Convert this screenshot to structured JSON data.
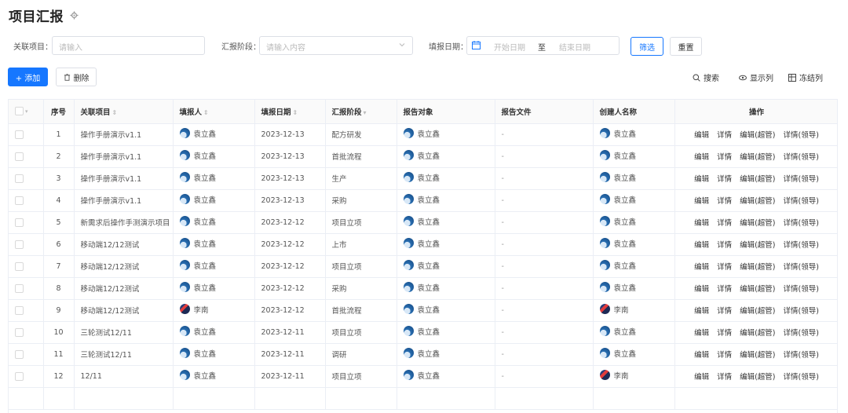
{
  "page": {
    "title": "项目汇报"
  },
  "filters": {
    "project_label": "关联项目：",
    "project_placeholder": "请输入",
    "stage_label": "汇报阶段：",
    "stage_placeholder": "请输入内容",
    "date_label": "填报日期：",
    "date_start_placeholder": "开始日期",
    "date_separator": "至",
    "date_end_placeholder": "结束日期",
    "filter_button": "筛选",
    "reset_button": "重置"
  },
  "toolbar": {
    "add_button": "+ 添加",
    "delete_button": "删除",
    "search": "搜索",
    "columns": "显示列",
    "freeze": "冻结列"
  },
  "table": {
    "headers": {
      "index": "序号",
      "project": "关联项目",
      "reporter": "填报人",
      "date": "填报日期",
      "stage": "汇报阶段",
      "target": "报告对象",
      "file": "报告文件",
      "creator": "创建人名称",
      "actions": "操作"
    },
    "actions": [
      "编辑",
      "详情",
      "编辑(超管)",
      "详情(领导)"
    ],
    "rows": [
      {
        "index": "1",
        "project": "操作手册演示v1.1",
        "reporter": "袁立鑫",
        "reporter_avatar": "blue",
        "date": "2023-12-13",
        "stage": "配方研发",
        "target": "袁立鑫",
        "file": "-",
        "creator": "袁立鑫",
        "creator_avatar": "blue"
      },
      {
        "index": "2",
        "project": "操作手册演示v1.1",
        "reporter": "袁立鑫",
        "reporter_avatar": "blue",
        "date": "2023-12-13",
        "stage": "首批流程",
        "target": "袁立鑫",
        "file": "-",
        "creator": "袁立鑫",
        "creator_avatar": "blue"
      },
      {
        "index": "3",
        "project": "操作手册演示v1.1",
        "reporter": "袁立鑫",
        "reporter_avatar": "blue",
        "date": "2023-12-13",
        "stage": "生产",
        "target": "袁立鑫",
        "file": "-",
        "creator": "袁立鑫",
        "creator_avatar": "blue"
      },
      {
        "index": "4",
        "project": "操作手册演示v1.1",
        "reporter": "袁立鑫",
        "reporter_avatar": "blue",
        "date": "2023-12-13",
        "stage": "采购",
        "target": "袁立鑫",
        "file": "-",
        "creator": "袁立鑫",
        "creator_avatar": "blue"
      },
      {
        "index": "5",
        "project": "新需求后操作手测演示项目",
        "reporter": "袁立鑫",
        "reporter_avatar": "blue",
        "date": "2023-12-12",
        "stage": "项目立项",
        "target": "袁立鑫",
        "file": "-",
        "creator": "袁立鑫",
        "creator_avatar": "blue"
      },
      {
        "index": "6",
        "project": "移动端12/12测试",
        "reporter": "袁立鑫",
        "reporter_avatar": "blue",
        "date": "2023-12-12",
        "stage": "上市",
        "target": "袁立鑫",
        "file": "-",
        "creator": "袁立鑫",
        "creator_avatar": "blue"
      },
      {
        "index": "7",
        "project": "移动端12/12测试",
        "reporter": "袁立鑫",
        "reporter_avatar": "blue",
        "date": "2023-12-12",
        "stage": "项目立项",
        "target": "袁立鑫",
        "file": "-",
        "creator": "袁立鑫",
        "creator_avatar": "blue"
      },
      {
        "index": "8",
        "project": "移动端12/12测试",
        "reporter": "袁立鑫",
        "reporter_avatar": "blue",
        "date": "2023-12-12",
        "stage": "采购",
        "target": "袁立鑫",
        "file": "-",
        "creator": "袁立鑫",
        "creator_avatar": "blue"
      },
      {
        "index": "9",
        "project": "移动端12/12测试",
        "reporter": "李南",
        "reporter_avatar": "red",
        "date": "2023-12-12",
        "stage": "首批流程",
        "target": "袁立鑫",
        "file": "-",
        "creator": "李南",
        "creator_avatar": "red"
      },
      {
        "index": "10",
        "project": "三轮测试12/11",
        "reporter": "袁立鑫",
        "reporter_avatar": "blue",
        "date": "2023-12-11",
        "stage": "项目立项",
        "target": "袁立鑫",
        "file": "-",
        "creator": "袁立鑫",
        "creator_avatar": "blue"
      },
      {
        "index": "11",
        "project": "三轮测试12/11",
        "reporter": "袁立鑫",
        "reporter_avatar": "blue",
        "date": "2023-12-11",
        "stage": "调研",
        "target": "袁立鑫",
        "file": "-",
        "creator": "袁立鑫",
        "creator_avatar": "blue"
      },
      {
        "index": "12",
        "project": "12/11",
        "reporter": "袁立鑫",
        "reporter_avatar": "blue",
        "date": "2023-12-11",
        "stage": "项目立项",
        "target": "袁立鑫",
        "file": "-",
        "creator": "李南",
        "creator_avatar": "red"
      }
    ]
  }
}
